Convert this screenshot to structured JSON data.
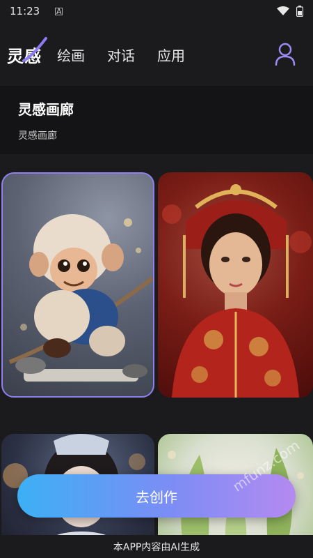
{
  "status_bar": {
    "time": "11:23",
    "notification_glyph": "A"
  },
  "nav": {
    "logo": "灵感",
    "items": [
      "绘画",
      "对话",
      "应用"
    ],
    "accent": "#9b8cf4"
  },
  "header": {
    "title": "灵感画廊",
    "subtitle": "灵感画廊"
  },
  "gallery": {
    "cards": [
      {
        "icon": "monkey-art-image"
      },
      {
        "icon": "girl-art-image"
      },
      {
        "icon": "lady-art-image"
      },
      {
        "icon": "plant-art-image"
      }
    ]
  },
  "cta": {
    "label": "去创作"
  },
  "watermark": {
    "text": "mfunz.com"
  },
  "footer": {
    "text": "本APP内容由AI生成"
  }
}
